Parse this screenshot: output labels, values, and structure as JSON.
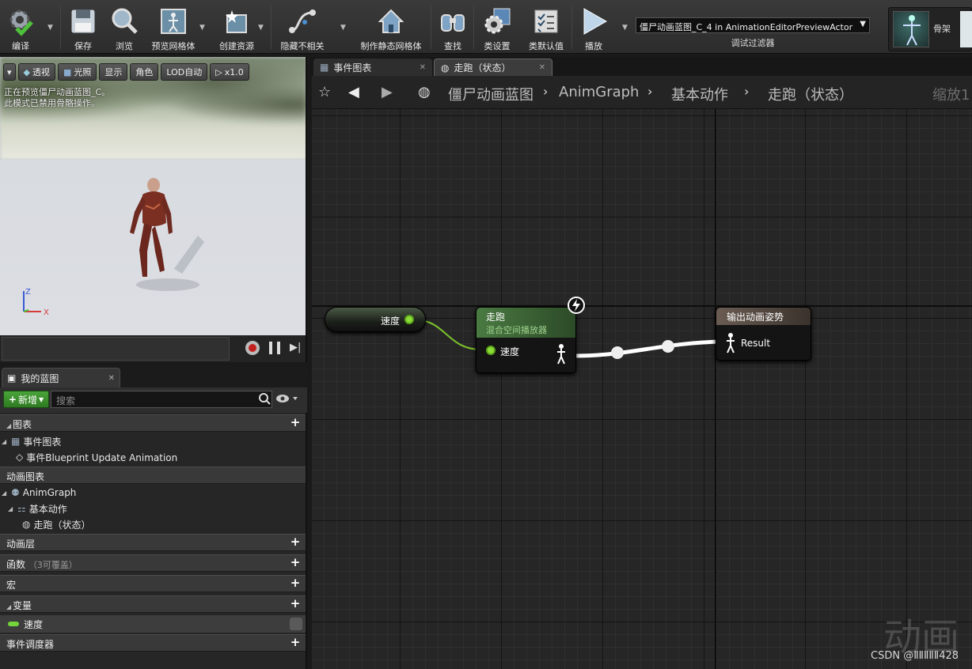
{
  "toolbar": {
    "compile": "编译",
    "save": "保存",
    "browse": "浏览",
    "preview_mesh": "预览网格体",
    "create_asset": "创建资源",
    "hide_unrelated": "隐藏不相关",
    "make_static_mesh": "制作静态网格体",
    "find": "查找",
    "class_settings": "类设置",
    "class_defaults": "类默认值",
    "play": "播放",
    "debug_filter_value": "僵尸动画蓝图_C_4 in AnimationEditorPreviewActor",
    "debug_filter_label": "调试过滤器",
    "skeleton": "骨架"
  },
  "viewport": {
    "buttons": [
      "透视",
      "光照",
      "显示",
      "角色",
      "LOD自动",
      "x1.0"
    ],
    "notice_line1": "正在预览僵尸动画蓝图_C。",
    "notice_line2": "此模式已禁用骨骼操作。",
    "axis_z": "Z",
    "axis_x": "X"
  },
  "my_blueprint": {
    "tab": "我的蓝图",
    "new": "新增",
    "search_placeholder": "搜索",
    "sections": {
      "graphs": "图表",
      "event_graph": "事件图表",
      "event_update": "事件Blueprint Update Animation",
      "anim_graphs": "动画图表",
      "anim_graph": "AnimGraph",
      "locomotion": "基本动作",
      "run_state": "走跑（状态）",
      "anim_layers": "动画层",
      "functions": "函数",
      "functions_note": "（3可覆盖）",
      "macros": "宏",
      "variables": "变量",
      "var_speed": "速度",
      "event_dispatchers": "事件调度器"
    }
  },
  "graph": {
    "tabs": [
      "事件图表",
      "走跑（状态）"
    ],
    "breadcrumb": [
      "僵尸动画蓝图",
      "AnimGraph",
      "基本动作",
      "走跑（状态）"
    ],
    "zoom": "缩放1",
    "nodes": {
      "speed_get": "速度",
      "blendspace_title": "走跑",
      "blendspace_subtitle": "混合空间播放器",
      "blendspace_pin": "速度",
      "output_title": "输出动画姿势",
      "output_pin": "Result"
    },
    "watermark": "动画",
    "credit": "CSDN @ⅡⅡⅡⅡⅡ428"
  },
  "colors": {
    "bool_pin": "#8bdc38",
    "node_blend_header": "#4a7a42",
    "node_output_header": "#6a5c52"
  }
}
